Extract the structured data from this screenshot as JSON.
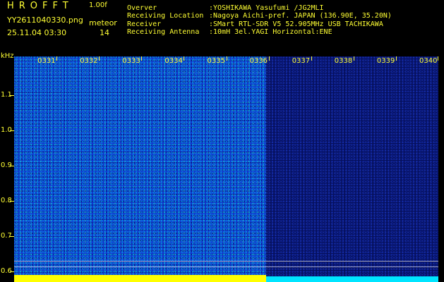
{
  "header": {
    "app_title": "HROFFT",
    "version": "1.00f",
    "filename": "YY2611040330.png",
    "datetime": "25.11.04 03:30",
    "event_type": "meteor",
    "event_count": "14"
  },
  "info": [
    {
      "label": "Overver",
      "value": ":YOSHIKAWA Yasufumi /JG2MLI"
    },
    {
      "label": "Receiving Location",
      "value": ":Nagoya Aichi-pref. JAPAN (136.90E, 35.20N)"
    },
    {
      "label": "Receiver",
      "value": ":SMart RTL-SDR V5 52.905MHz USB TACHIKAWA"
    },
    {
      "label": "Receiving Antenna",
      "value": ":10mH 3el.YAGI Horizontal:ENE"
    }
  ],
  "colors": {
    "text": "#ffff33",
    "active_panel": "#1236cc",
    "inactive_panel": "#06105e",
    "bottom_active": "#ffff00",
    "bottom_inactive": "#00e5ff"
  },
  "chart_data": {
    "type": "heatmap",
    "y_unit": "kHz",
    "y_ticks": [
      "1.1",
      "1.0",
      "0.9",
      "0.8",
      "0.7",
      "0.6"
    ],
    "x_ticks": [
      "0331",
      "0332",
      "0333",
      "0334",
      "0335",
      "0336",
      "0337",
      "0338",
      "0339",
      "0340"
    ],
    "ylim": [
      0.57,
      1.21
    ]
  }
}
